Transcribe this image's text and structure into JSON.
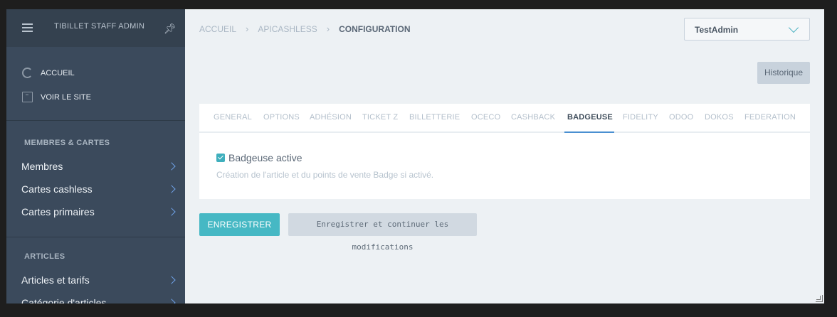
{
  "sidebar": {
    "brand": "TIBILLET STAFF ADMIN",
    "links": [
      {
        "label": "ACCUEIL",
        "icon": "circle-icon"
      },
      {
        "label": "VOIR LE SITE",
        "icon": "external-site-icon"
      }
    ],
    "sections": [
      {
        "title": "MEMBRES & CARTES",
        "items": [
          "Membres",
          "Cartes cashless",
          "Cartes primaires"
        ]
      },
      {
        "title": "ARTICLES",
        "items": [
          "Articles et tarifs",
          "Catégorie d'articles"
        ]
      }
    ]
  },
  "breadcrumb": {
    "items": [
      "ACCUEIL",
      "APICASHLESS"
    ],
    "current": "CONFIGURATION"
  },
  "user_select": {
    "value": "TestAdmin"
  },
  "history_button": "Historique",
  "tabs": [
    "GENERAL",
    "OPTIONS",
    "ADHÉSION",
    "TICKET Z",
    "BILLETTERIE",
    "OCECO",
    "CASHBACK",
    "BADGEUSE",
    "FIDELITY",
    "ODOO",
    "DOKOS",
    "FEDERATION"
  ],
  "active_tab": "BADGEUSE",
  "form": {
    "checkbox_label": "Badgeuse active",
    "checkbox_checked": true,
    "help_text": "Création de l'article et du points de vente Badge si activé."
  },
  "buttons": {
    "save": "ENREGISTRER",
    "save_continue": "Enregistrer et continuer les modifications"
  },
  "colors": {
    "accent": "#46b8c4",
    "sidebar": "#3b4a5c",
    "tab_active_underline": "#4a8fd1"
  }
}
